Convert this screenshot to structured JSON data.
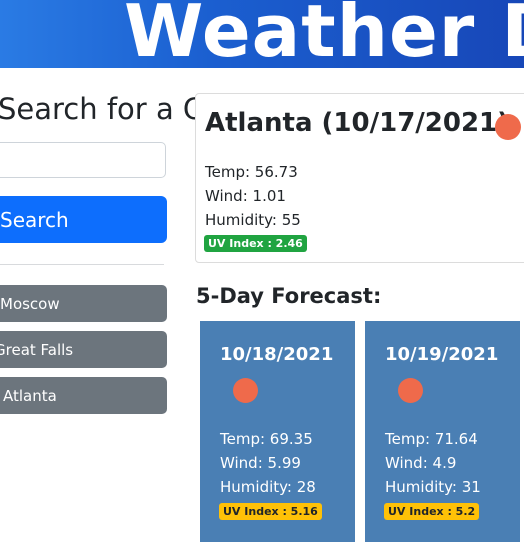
{
  "header": {
    "title": "Weather Dashboard"
  },
  "search": {
    "heading": "Search for a City:",
    "input_value": "",
    "button_label": "Search"
  },
  "history": [
    {
      "label": "Moscow"
    },
    {
      "label": "Great Falls"
    },
    {
      "label": "Atlanta"
    }
  ],
  "current": {
    "title": "Atlanta (10/17/2021)",
    "icon": "sun-icon",
    "temp": "Temp: 56.73",
    "wind": "Wind: 1.01",
    "humidity": "Humidity: 55",
    "uv": "UV Index : 2.46",
    "uv_color": "#20a441"
  },
  "forecast": {
    "heading": "5-Day Forecast:",
    "days": [
      {
        "date": "10/18/2021",
        "icon": "sun-icon",
        "temp": "Temp: 69.35",
        "wind": "Wind: 5.99",
        "humidity": "Humidity: 28",
        "uv": "UV Index : 5.16",
        "uv_color": "#ffc107"
      },
      {
        "date": "10/19/2021",
        "icon": "sun-icon",
        "temp": "Temp: 71.64",
        "wind": "Wind: 4.9",
        "humidity": "Humidity: 31",
        "uv": "UV Index : 5.2",
        "uv_color": "#ffc107"
      }
    ]
  },
  "colors": {
    "header_bg": "#1b5fd0",
    "search_button": "#0d6efd",
    "history_button": "#6c757d",
    "forecast_card": "#4a7fb4",
    "weather_icon": "#ef6a4b"
  }
}
